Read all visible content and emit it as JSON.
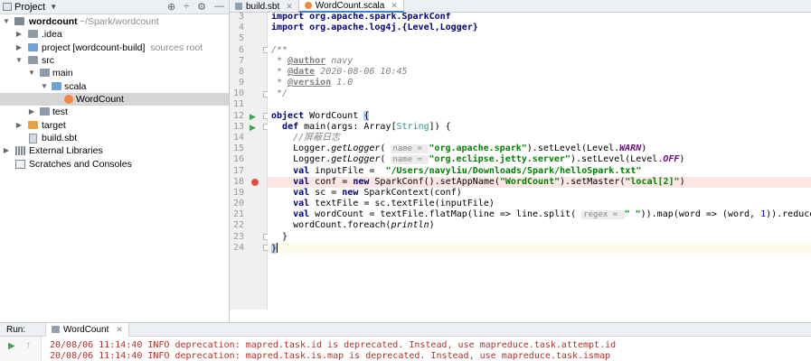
{
  "project_panel": {
    "title": "Project",
    "tree": [
      {
        "label": "wordcount",
        "suffix": "~/Spark/wordcount",
        "bold": true,
        "depth": 0,
        "arrow": "▼",
        "icon": "folder-dark"
      },
      {
        "label": ".idea",
        "depth": 1,
        "arrow": "▶",
        "icon": "folder"
      },
      {
        "label": "project [wordcount-build]",
        "suffix": "sources root",
        "depth": 1,
        "arrow": "▶",
        "icon": "folder-blue"
      },
      {
        "label": "src",
        "depth": 1,
        "arrow": "▼",
        "icon": "folder"
      },
      {
        "label": "main",
        "depth": 2,
        "arrow": "▼",
        "icon": "folder"
      },
      {
        "label": "scala",
        "depth": 3,
        "arrow": "▼",
        "icon": "folder-blue"
      },
      {
        "label": "WordCount",
        "depth": 4,
        "arrow": "",
        "icon": "scala-file",
        "selected": true
      },
      {
        "label": "test",
        "depth": 2,
        "arrow": "▶",
        "icon": "folder"
      },
      {
        "label": "target",
        "depth": 1,
        "arrow": "▶",
        "icon": "folder-orange"
      },
      {
        "label": "build.sbt",
        "depth": 1,
        "arrow": "",
        "icon": "sbt-file"
      },
      {
        "label": "External Libraries",
        "depth": 0,
        "arrow": "▶",
        "icon": "lib-icon"
      },
      {
        "label": "Scratches and Consoles",
        "depth": 0,
        "arrow": "",
        "icon": "scratch-icon"
      }
    ]
  },
  "editor": {
    "tabs": [
      {
        "label": "build.sbt",
        "active": false
      },
      {
        "label": "WordCount.scala",
        "active": true
      }
    ],
    "line_numbers": [
      "3",
      "4",
      "5",
      "6",
      "7",
      "8",
      "9",
      "10",
      "11",
      "12",
      "13",
      "14",
      "15",
      "16",
      "17",
      "18",
      "19",
      "20",
      "21",
      "22",
      "23",
      "24"
    ],
    "code": {
      "l3": "import org.apache.spark.SparkConf",
      "l4": "import org.apache.log4j.{Level,Logger}",
      "l6": "/**",
      "l7_star": " * ",
      "l7_tag": "@author",
      "l7_val": " navy",
      "l8_star": " * ",
      "l8_tag": "@date",
      "l8_val": " 2020-08-06 10:45",
      "l9_star": " * ",
      "l9_tag": "@version",
      "l9_val": " 1.0",
      "l10": " */",
      "l12_kw": "object",
      "l12_name": " WordCount ",
      "l12_brace": "{",
      "l13_indent": "  ",
      "l13_kw": "def",
      "l13_a": " main(args: Array[",
      "l13_type": "String",
      "l13_b": "]) {",
      "l14": "    //屏蔽日志",
      "l15_a": "    Logger.",
      "l15_fn": "getLogger",
      "l15_b": "( ",
      "l15_hint": "name = ",
      "l15_str": "\"org.apache.spark\"",
      "l15_c": ").setLevel(Level.",
      "l15_fld": "WARN",
      "l15_d": ")",
      "l16_a": "    Logger.",
      "l16_fn": "getLogger",
      "l16_b": "( ",
      "l16_hint": "name = ",
      "l16_str": "\"org.eclipse.jetty.server\"",
      "l16_c": ").setLevel(Level.",
      "l16_fld": "OFF",
      "l16_d": ")",
      "l17_indent": "    ",
      "l17_kw": "val",
      "l17_a": " inputFile =  ",
      "l17_str": "\"/Users/navyliu/Downloads/Spark/helloSpark.txt\"",
      "l18_indent": "    ",
      "l18_kw": "val",
      "l18_a": " conf = ",
      "l18_kw2": "new",
      "l18_b": " SparkConf().setAppName(",
      "l18_str": "\"WordCount\"",
      "l18_c": ").setMaster(",
      "l18_str2": "\"local[2]\"",
      "l18_d": ")",
      "l19_indent": "    ",
      "l19_kw": "val",
      "l19_a": " sc = ",
      "l19_kw2": "new",
      "l19_b": " SparkContext(conf)",
      "l20_indent": "    ",
      "l20_kw": "val",
      "l20_a": " textFile = sc.textFile(inputFile)",
      "l21_indent": "    ",
      "l21_kw": "val",
      "l21_a": " wordCount = textFile.flatMap(line => line.split( ",
      "l21_hint": "regex = ",
      "l21_str": "\" \"",
      "l21_b": ")).map(word => (word, ",
      "l21_num": "1",
      "l21_c": ")).reduceByKey(",
      "l22_a": "    wordCount.foreach(",
      "l22_it": "println",
      "l22_b": ")",
      "l23": "  }",
      "l24": "}"
    }
  },
  "run_panel": {
    "label": "Run:",
    "tab_label": "WordCount",
    "console": [
      "20/08/06 11:14:40 INFO deprecation: mapred.task.id is deprecated. Instead, use mapreduce.task.attempt.id",
      "20/08/06 11:14:40 INFO deprecation: mapred.task.is.map is deprecated. Instead, use mapreduce.task.ismap"
    ]
  }
}
